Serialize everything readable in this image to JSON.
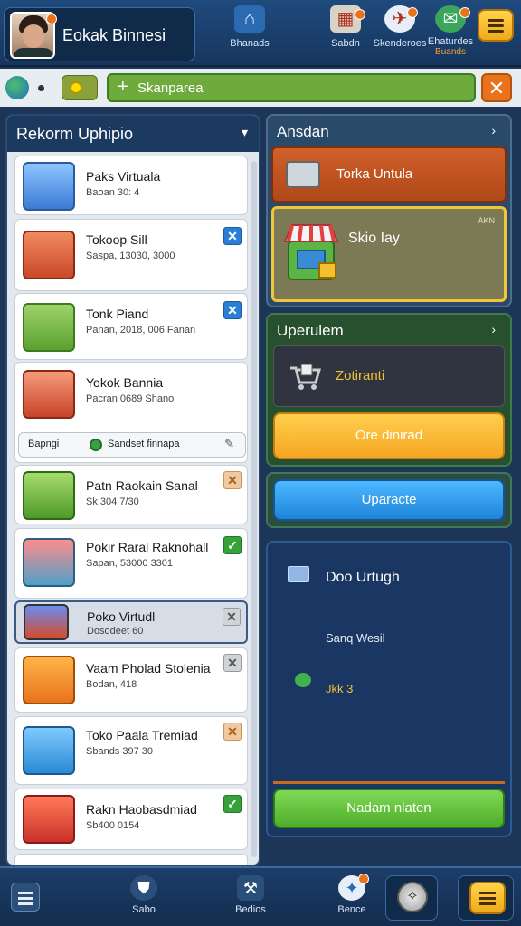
{
  "colors": {
    "accent_orange": "#e8731c",
    "accent_green": "#6faa3c",
    "accent_blue": "#1f84d8",
    "panel_dark": "#1c3a60",
    "gold_border": "#f0c53a"
  },
  "profile": {
    "name": "Eokak Binnesi",
    "avatar_icon": "user-avatar"
  },
  "top_nav": [
    {
      "label": "Bhanads",
      "sublabel": "",
      "icon": "shop-icon"
    },
    {
      "label": "Sabdn",
      "sublabel": "",
      "icon": "calendar-icon"
    },
    {
      "label": "Skenderoes",
      "sublabel": "",
      "icon": "chat-icon"
    },
    {
      "label": "Ehaturdes",
      "sublabel": "Buands",
      "icon": "globe-icon"
    }
  ],
  "search": {
    "value": "Skanparea",
    "plus": "+",
    "close": "✕"
  },
  "left_panel": {
    "title": "Rekorm Uphipio",
    "chevron": "▾",
    "items": [
      {
        "name": "Paks Virtuala",
        "meta": "Baoan 30: 4",
        "check": ""
      },
      {
        "name": "Tokoop Sill",
        "meta": "Saspa, 13030, 3000",
        "check": "✕"
      },
      {
        "name": "Tonk Piand",
        "meta": "Panan, 2018, 006 Fanan",
        "check": "✕"
      },
      {
        "name": "Yokok Bannia",
        "meta": "Pacran 0689 Shano",
        "check": ""
      },
      {
        "name": "Patn Raokain Sanal",
        "meta": "Sk.304 7/30",
        "check": "✕"
      },
      {
        "name": "Pokir Raral Raknohall",
        "meta": "Sapan, 53000 3301",
        "check": "✓"
      },
      {
        "name": "Poko Virtudl",
        "meta": "Dosodeet 60",
        "check": "✕"
      },
      {
        "name": "Vaam Pholad Stolenia",
        "meta": "Bodan, 418",
        "check": "✕"
      },
      {
        "name": "Toko Paala Tremiad",
        "meta": "Sbands 397 30",
        "check": "✕"
      },
      {
        "name": "Rakn Haobasdmiad",
        "meta": "Sb400 0154",
        "check": "✓"
      }
    ],
    "subrow": {
      "left": "Bapngi",
      "right": "Sandset finnapa",
      "edit_icon": "✎"
    }
  },
  "right_panel": {
    "section1_title": "Ansdan",
    "chevron": "›",
    "card_orange": "Torka Untula",
    "card_gold": "Skio Iay",
    "card_gold_tag": "AKN",
    "section2_title": "Uperulem",
    "dark_card": "Zotiranti",
    "btn_orange": "Ore dinirad",
    "btn_blue": "Uparacte",
    "section3": {
      "t1": "Doo Urtugh",
      "t2": "Sanq Wesil",
      "t3": "Jkk 3",
      "btn_green": "Nadam nlaten"
    }
  },
  "bottom_nav": [
    {
      "label": "Sabo",
      "icon": "shield-icon"
    },
    {
      "label": "Bedios",
      "icon": "tools-icon"
    },
    {
      "label": "Bence",
      "icon": "chat-bubble-icon"
    }
  ]
}
